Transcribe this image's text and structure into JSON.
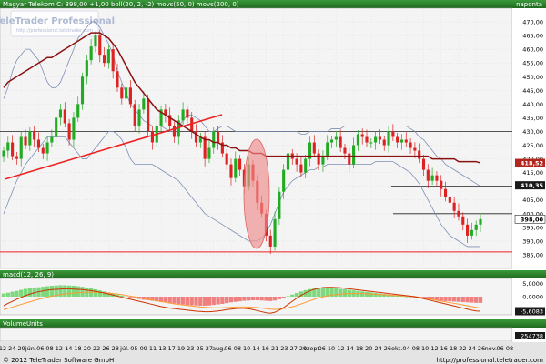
{
  "header": {
    "instrument_line": "Magyar Telekom C: 398,00 +1,00 boll(20, 2, -2) movs(50, 0) movs(200, 0)",
    "period": "napontа"
  },
  "watermark": {
    "brand": "TeleTrader Professional",
    "url": "http://professional.teletrader.com"
  },
  "footer": {
    "copyright": "© 2012 TeleTrader Software GmbH",
    "url": "http://professional.teletrader.com"
  },
  "colors": {
    "title_bar": "#2f7f2f",
    "price_bg": "#f4f4f4",
    "up_candle": "#22aa22",
    "down_candle": "#dd2222",
    "ma50": "#8b1010",
    "boll": "#7e8fb5",
    "macd_hist_pos": "#7ed87e",
    "macd_hist_neg": "#f08080",
    "macd_line": "#cc3300",
    "signal_line": "#ff9933",
    "trend_line": "#ee2222",
    "ellipse": "#f08c8c"
  },
  "chart_data": [
    {
      "type": "candlestick",
      "title": "Magyar Telekom C: 398,00 +1,00 boll(20, 2, -2) movs(50, 0) movs(200, 0)",
      "period": "napontа",
      "ylim": [
        380,
        475
      ],
      "y_ticks": [
        385,
        390,
        395,
        400,
        405,
        410,
        415,
        420,
        425,
        430,
        435,
        440,
        445,
        450,
        455,
        460,
        465,
        470
      ],
      "y_tick_labels": [
        "385,00",
        "390,00",
        "395,00",
        "400,00",
        "405,00",
        "410,00",
        "415,00",
        "420,00",
        "425,00",
        "430,00",
        "435,00",
        "440,00",
        "445,00",
        "450,00",
        "455,00",
        "460,00",
        "465,00",
        "470,00"
      ],
      "price_badges": [
        {
          "value": 418.52,
          "label": "418,52"
        },
        {
          "value": 410.35,
          "label": "410,35"
        },
        {
          "value": 398,
          "label": "398,00"
        }
      ],
      "horizontal_levels": [
        430,
        410,
        400,
        386
      ],
      "close": [
        423,
        426,
        421,
        420,
        428,
        425,
        430,
        427,
        424,
        422,
        426,
        428,
        435,
        438,
        433,
        427,
        435,
        440,
        450,
        456,
        461,
        465,
        458,
        455,
        460,
        452,
        446,
        442,
        446,
        440,
        432,
        438,
        442,
        430,
        426,
        432,
        438,
        436,
        432,
        428,
        434,
        438,
        435,
        430,
        426,
        428,
        420,
        424,
        430,
        426,
        422,
        418,
        413,
        420,
        416,
        410,
        418,
        412,
        404,
        400,
        392,
        388,
        398,
        408,
        416,
        422,
        420,
        418,
        415,
        420,
        426,
        422,
        418,
        421,
        426,
        427,
        428,
        424,
        422,
        418,
        425,
        429,
        428,
        426,
        426,
        428,
        427,
        425,
        430,
        428,
        426,
        427,
        426,
        424,
        423,
        420,
        416,
        412,
        414,
        412,
        409,
        406,
        404,
        401,
        399,
        396,
        392,
        394,
        396,
        398
      ],
      "ma50": [
        446,
        448,
        449,
        450,
        451,
        452,
        453,
        454,
        455,
        456,
        457,
        457,
        458,
        459,
        460,
        461,
        462,
        463,
        464,
        465,
        466,
        466,
        466,
        465,
        464,
        462,
        460,
        457,
        454,
        451,
        448,
        446,
        444,
        442,
        440,
        438,
        437,
        436,
        435,
        434,
        433,
        432,
        431,
        430,
        429,
        428,
        427,
        427,
        426,
        426,
        425,
        425,
        424,
        424,
        423,
        423,
        423,
        422,
        422,
        422,
        421,
        421,
        421,
        421,
        421,
        421,
        421,
        421,
        421,
        421,
        421,
        421,
        421,
        421,
        421,
        421,
        421,
        421,
        421,
        421,
        421,
        421,
        421,
        421,
        421,
        421,
        421,
        421,
        421,
        421,
        421,
        421,
        421,
        421,
        421,
        421,
        421,
        421,
        420,
        420,
        420,
        420,
        420,
        420,
        419,
        419,
        419,
        419,
        419,
        418.5
      ],
      "boll_upper": [
        442,
        446,
        452,
        456,
        458,
        460,
        460,
        458,
        456,
        452,
        448,
        446,
        446,
        448,
        452,
        456,
        460,
        464,
        466,
        468,
        470,
        470,
        468,
        465,
        462,
        458,
        452,
        448,
        444,
        440,
        438,
        436,
        434,
        433,
        432,
        432,
        432,
        431,
        430,
        430,
        432,
        434,
        436,
        436,
        435,
        434,
        432,
        430,
        430,
        431,
        432,
        432,
        431,
        430,
        430,
        430,
        430,
        430,
        430,
        430,
        430,
        430,
        430,
        430,
        430,
        430,
        430,
        430,
        429,
        429,
        430,
        430,
        430,
        430,
        430,
        431,
        431,
        431,
        432,
        432,
        432,
        432,
        432,
        432,
        432,
        432,
        432,
        432,
        432,
        432,
        432,
        432,
        432,
        431,
        430,
        428,
        427,
        425,
        423,
        421,
        420,
        418,
        417,
        416,
        415,
        414,
        413,
        412,
        411,
        410
      ],
      "boll_lower": [
        400,
        404,
        408,
        412,
        415,
        418,
        420,
        422,
        424,
        426,
        428,
        428,
        428,
        428,
        428,
        426,
        424,
        422,
        420,
        420,
        422,
        424,
        426,
        428,
        430,
        430,
        429,
        427,
        424,
        420,
        418,
        418,
        418,
        418,
        418,
        417,
        416,
        415,
        414,
        413,
        412,
        410,
        408,
        406,
        404,
        402,
        400,
        399,
        398,
        397,
        396,
        395,
        394,
        393,
        392,
        391,
        390,
        390,
        390,
        391,
        393,
        396,
        400,
        404,
        408,
        410,
        412,
        413,
        414,
        415,
        416,
        416,
        417,
        417,
        418,
        418,
        418,
        418,
        418,
        418,
        418,
        418,
        418,
        418,
        418,
        419,
        419,
        419,
        419,
        419,
        418,
        417,
        416,
        415,
        413,
        411,
        408,
        405,
        402,
        399,
        396,
        394,
        392,
        391,
        390,
        389,
        388,
        388,
        388,
        388
      ]
    },
    {
      "type": "bar+line",
      "title": "macd(12, 26, 9)",
      "ylim": [
        -7,
        7
      ],
      "y_ticks": [
        5,
        0,
        -5.6083
      ],
      "y_tick_labels": [
        "5,0000",
        "0,0000",
        "-5,6083"
      ],
      "histogram": [
        1.2,
        1.5,
        1.9,
        2.2,
        2.6,
        3.0,
        3.2,
        3.4,
        3.6,
        3.8,
        4.0,
        4.2,
        4.3,
        4.4,
        4.4,
        4.3,
        4.2,
        4.0,
        3.8,
        3.5,
        3.2,
        2.8,
        2.4,
        2.0,
        1.6,
        1.2,
        0.8,
        0.4,
        0.1,
        -0.3,
        -0.6,
        -0.9,
        -1.2,
        -1.4,
        -1.6,
        -1.8,
        -2.0,
        -2.2,
        -2.4,
        -2.6,
        -2.8,
        -3.0,
        -3.2,
        -3.3,
        -3.4,
        -3.5,
        -3.5,
        -3.4,
        -3.2,
        -3.0,
        -2.8,
        -2.5,
        -2.2,
        -2.0,
        -1.8,
        -1.6,
        -1.5,
        -1.4,
        -1.4,
        -1.5,
        -1.6,
        -1.7,
        -1.5,
        -1.0,
        -0.4,
        0.2,
        0.8,
        1.4,
        2.0,
        2.5,
        2.9,
        3.1,
        3.3,
        3.4,
        3.4,
        3.3,
        3.2,
        3.0,
        2.8,
        2.6,
        2.4,
        2.2,
        2.0,
        1.8,
        1.6,
        1.4,
        1.2,
        1.0,
        0.8,
        0.6,
        0.4,
        0.2,
        0.0,
        -0.2,
        -0.4,
        -0.6,
        -0.8,
        -1.0,
        -1.2,
        -1.4,
        -1.6,
        -1.7,
        -1.8,
        -1.9,
        -2.0,
        -2.1,
        -2.2,
        -2.3,
        -2.4,
        -2.4
      ],
      "macd": [
        -3.5,
        -2.6,
        -1.8,
        -1.0,
        -0.3,
        0.4,
        1.0,
        1.5,
        1.9,
        2.2,
        2.5,
        2.7,
        2.8,
        2.9,
        3.0,
        3.0,
        2.9,
        2.8,
        2.7,
        2.5,
        2.3,
        2.0,
        1.7,
        1.4,
        1.0,
        0.6,
        0.2,
        -0.2,
        -0.6,
        -1.0,
        -1.4,
        -1.8,
        -2.2,
        -2.6,
        -3.0,
        -3.4,
        -3.8,
        -4.1,
        -4.4,
        -4.6,
        -4.8,
        -5.0,
        -5.2,
        -5.4,
        -5.6,
        -5.7,
        -5.8,
        -5.8,
        -5.7,
        -5.5,
        -5.3,
        -5.0,
        -4.8,
        -4.6,
        -4.5,
        -4.5,
        -4.7,
        -5.0,
        -5.4,
        -5.8,
        -6.2,
        -6.4,
        -6.0,
        -5.2,
        -4.2,
        -3.0,
        -1.8,
        -0.6,
        0.5,
        1.4,
        2.2,
        2.8,
        3.2,
        3.5,
        3.6,
        3.6,
        3.5,
        3.4,
        3.2,
        3.0,
        2.8,
        2.6,
        2.4,
        2.2,
        2.0,
        1.8,
        1.6,
        1.4,
        1.2,
        1.0,
        0.8,
        0.6,
        0.4,
        0.2,
        0.0,
        -0.4,
        -0.8,
        -1.2,
        -1.6,
        -2.0,
        -2.4,
        -2.8,
        -3.2,
        -3.6,
        -4.0,
        -4.4,
        -4.8,
        -5.2,
        -5.5,
        -5.6
      ],
      "signal": [
        -5.0,
        -4.5,
        -4.0,
        -3.5,
        -3.0,
        -2.5,
        -2.0,
        -1.5,
        -1.0,
        -0.6,
        -0.2,
        0.2,
        0.5,
        0.8,
        1.0,
        1.2,
        1.4,
        1.5,
        1.6,
        1.7,
        1.7,
        1.7,
        1.6,
        1.5,
        1.4,
        1.2,
        1.0,
        0.8,
        0.5,
        0.2,
        -0.1,
        -0.4,
        -0.7,
        -1.0,
        -1.3,
        -1.6,
        -1.9,
        -2.2,
        -2.5,
        -2.8,
        -3.0,
        -3.2,
        -3.4,
        -3.6,
        -3.8,
        -4.0,
        -4.1,
        -4.2,
        -4.3,
        -4.3,
        -4.3,
        -4.2,
        -4.1,
        -4.0,
        -4.0,
        -4.0,
        -4.0,
        -4.1,
        -4.2,
        -4.4,
        -4.6,
        -4.8,
        -4.9,
        -4.8,
        -4.6,
        -4.3,
        -3.9,
        -3.4,
        -2.8,
        -2.2,
        -1.6,
        -1.0,
        -0.5,
        -0.1,
        0.3,
        0.6,
        0.8,
        1.0,
        1.1,
        1.2,
        1.2,
        1.2,
        1.2,
        1.1,
        1.0,
        0.9,
        0.8,
        0.7,
        0.6,
        0.5,
        0.4,
        0.3,
        0.2,
        0.1,
        0.0,
        -0.2,
        -0.5,
        -0.8,
        -1.1,
        -1.4,
        -1.7,
        -2.0,
        -2.3,
        -2.6,
        -2.9,
        -3.2,
        -3.5,
        -3.8,
        -4.1,
        -4.4
      ]
    },
    {
      "type": "bar",
      "title": "VolumeUnits",
      "y_tick_labels": [
        "254738"
      ]
    }
  ],
  "x_axis": {
    "labels": [
      "12",
      "24",
      "29",
      "jún.",
      "06",
      "08",
      "12",
      "14",
      "18",
      "20",
      "22",
      "26",
      "28",
      "júl.",
      "05",
      "09",
      "11",
      "13",
      "17",
      "19",
      "23",
      "25",
      "27",
      "aug.",
      "06",
      "08",
      "10",
      "14",
      "16",
      "21",
      "23",
      "27",
      "29",
      "szept.",
      "06",
      "10",
      "12",
      "14",
      "18",
      "20",
      "24",
      "26",
      "okt.",
      "04",
      "08",
      "10",
      "12",
      "16",
      "18",
      "22",
      "24",
      "26",
      "nov.",
      "06",
      "08"
    ]
  }
}
